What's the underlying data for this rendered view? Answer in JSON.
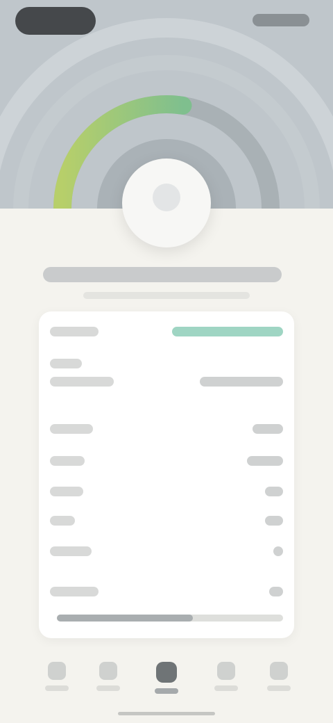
{
  "colors": {
    "hero_background": "#bfc6cb",
    "gauge_start": "#b7cf6a",
    "gauge_end": "#7fbf8e",
    "accent": "#9fd5c3",
    "page_background": "#f4f3ee",
    "card_background": "#ffffff"
  },
  "hero": {
    "gauge_icon": "gauge-arc-icon",
    "gauge_level": 0.55,
    "profile_icon": "profile-icon"
  },
  "card": {
    "rows": [
      {
        "label": "",
        "value": "",
        "accent": true
      },
      {
        "label": "",
        "value": ""
      },
      {
        "label": "",
        "value": ""
      },
      {
        "label": "",
        "value": ""
      },
      {
        "label": "",
        "value": ""
      },
      {
        "label": "",
        "value": ""
      },
      {
        "label": "",
        "value": ""
      },
      {
        "label": "",
        "value": ""
      }
    ],
    "progress_level": 0.6
  },
  "tabbar": {
    "tabs": [
      {
        "icon": "home-icon",
        "label": ""
      },
      {
        "icon": "stats-icon",
        "label": ""
      },
      {
        "icon": "scan-icon",
        "label": "",
        "active": true
      },
      {
        "icon": "list-icon",
        "label": ""
      },
      {
        "icon": "profile-icon",
        "label": ""
      }
    ]
  }
}
